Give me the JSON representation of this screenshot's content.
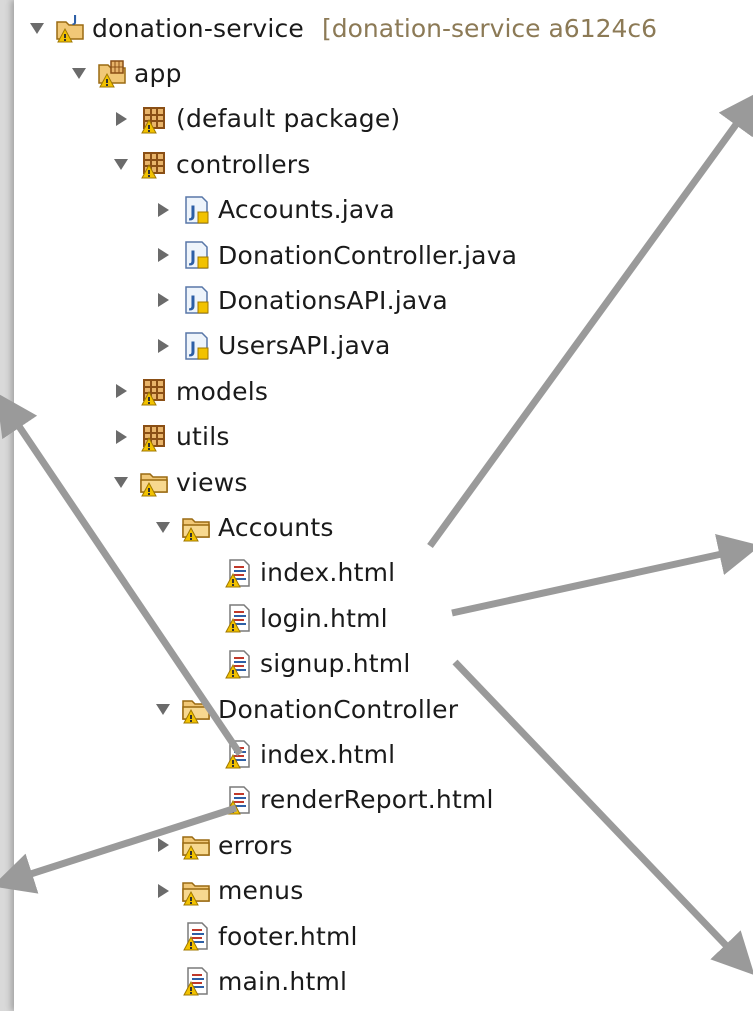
{
  "colors": {
    "background": "#d9d9d9",
    "panel": "#ffffff",
    "arrow": "#9a9a9a",
    "text": "#1a1a1a",
    "decoration": "#8c7a56"
  },
  "tree": [
    {
      "id": "project",
      "label": "donation-service",
      "suffix": "[donation-service a6124c6",
      "depth": 0,
      "expanded": true,
      "icon": "project-icon"
    },
    {
      "id": "app",
      "label": "app",
      "depth": 1,
      "expanded": true,
      "icon": "source-folder-icon"
    },
    {
      "id": "default-package",
      "label": "(default package)",
      "depth": 2,
      "expanded": false,
      "icon": "package-icon"
    },
    {
      "id": "controllers",
      "label": "controllers",
      "depth": 2,
      "expanded": true,
      "icon": "package-icon"
    },
    {
      "id": "accounts-java",
      "label": "Accounts.java",
      "depth": 3,
      "expanded": false,
      "icon": "java-file-icon"
    },
    {
      "id": "donationcontroller-java",
      "label": "DonationController.java",
      "depth": 3,
      "expanded": false,
      "icon": "java-file-icon"
    },
    {
      "id": "donationsapi-java",
      "label": "DonationsAPI.java",
      "depth": 3,
      "expanded": false,
      "icon": "java-file-icon"
    },
    {
      "id": "usersapi-java",
      "label": "UsersAPI.java",
      "depth": 3,
      "expanded": false,
      "icon": "java-file-icon"
    },
    {
      "id": "models",
      "label": "models",
      "depth": 2,
      "expanded": false,
      "icon": "package-icon"
    },
    {
      "id": "utils",
      "label": "utils",
      "depth": 2,
      "expanded": false,
      "icon": "package-icon"
    },
    {
      "id": "views",
      "label": "views",
      "depth": 2,
      "expanded": true,
      "icon": "folder-icon"
    },
    {
      "id": "accounts-folder",
      "label": "Accounts",
      "depth": 3,
      "expanded": true,
      "icon": "folder-icon"
    },
    {
      "id": "accounts-index",
      "label": "index.html",
      "depth": 4,
      "leaf": true,
      "icon": "html-file-icon"
    },
    {
      "id": "accounts-login",
      "label": "login.html",
      "depth": 4,
      "leaf": true,
      "icon": "html-file-icon"
    },
    {
      "id": "accounts-signup",
      "label": "signup.html",
      "depth": 4,
      "leaf": true,
      "icon": "html-file-icon"
    },
    {
      "id": "donationcontroller-folder",
      "label": "DonationController",
      "depth": 3,
      "expanded": true,
      "icon": "folder-icon"
    },
    {
      "id": "dc-index",
      "label": "index.html",
      "depth": 4,
      "leaf": true,
      "icon": "html-file-icon"
    },
    {
      "id": "dc-renderreport",
      "label": "renderReport.html",
      "depth": 4,
      "leaf": true,
      "icon": "html-file-icon"
    },
    {
      "id": "errors",
      "label": "errors",
      "depth": 3,
      "expanded": false,
      "icon": "folder-icon"
    },
    {
      "id": "menus",
      "label": "menus",
      "depth": 3,
      "expanded": false,
      "icon": "folder-icon"
    },
    {
      "id": "footer",
      "label": "footer.html",
      "depth": 3,
      "leaf": true,
      "icon": "html-file-icon"
    },
    {
      "id": "main",
      "label": "main.html",
      "depth": 3,
      "leaf": true,
      "icon": "html-file-icon"
    }
  ]
}
